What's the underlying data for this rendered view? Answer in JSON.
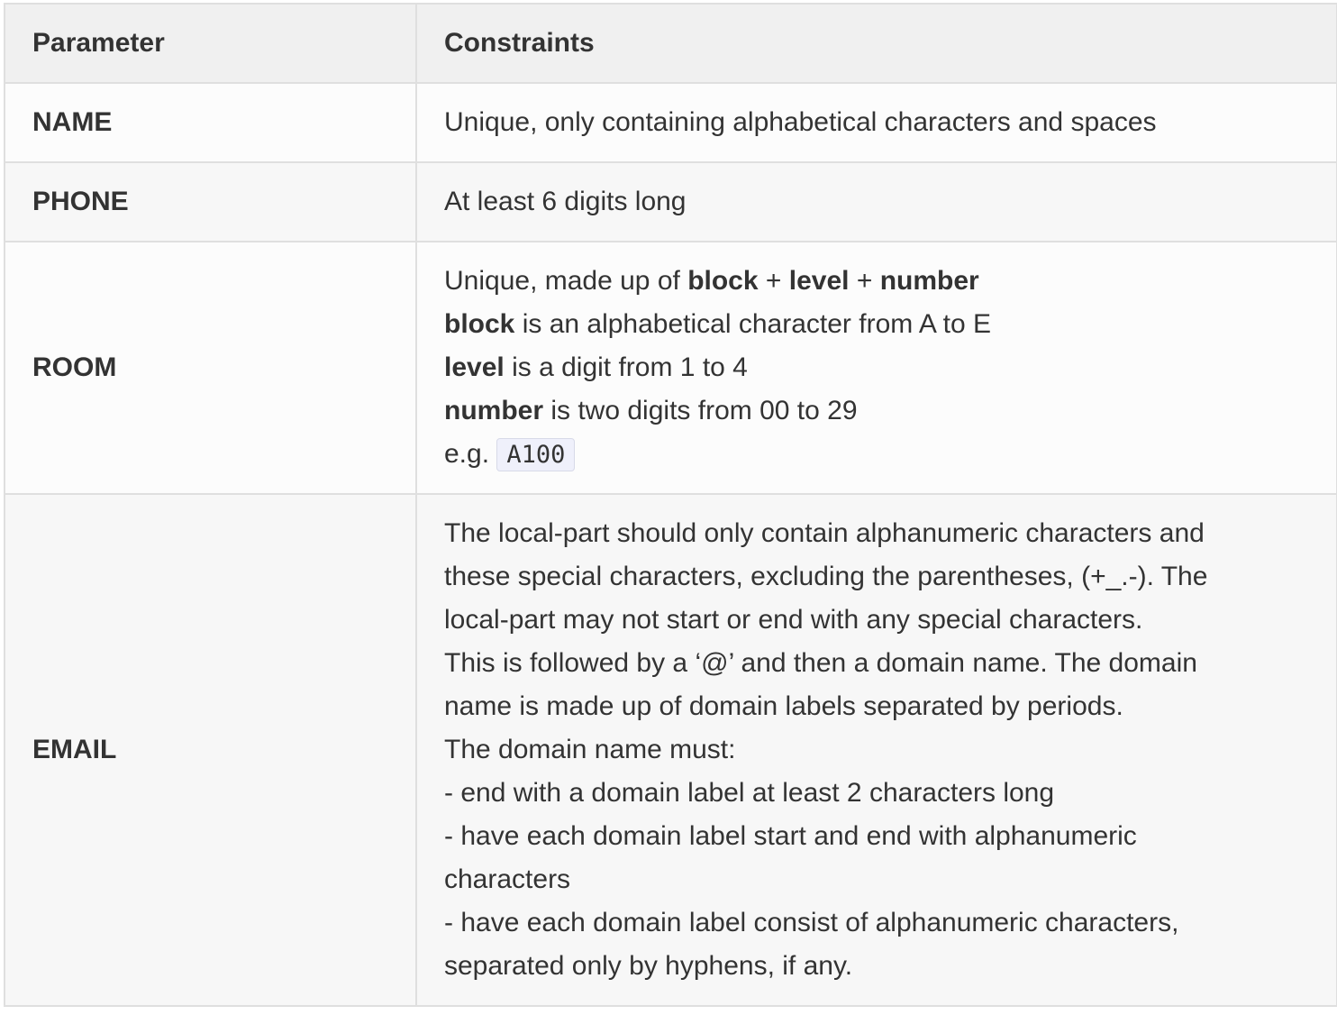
{
  "table": {
    "headers": {
      "parameter": "Parameter",
      "constraints": "Constraints"
    },
    "rows": {
      "name": {
        "param": "NAME",
        "constraint": "Unique, only containing alphabetical characters and spaces"
      },
      "phone": {
        "param": "PHONE",
        "constraint": "At least 6 digits long"
      },
      "room": {
        "param": "ROOM",
        "line1_prefix": "Unique, made up of ",
        "kw_block": "block",
        "plus": " + ",
        "kw_level": "level",
        "kw_number": "number",
        "line2_rest": " is an alphabetical character from A to E",
        "line3_rest": " is a digit from 1 to 4",
        "line4_rest": " is two digits from 00 to 29",
        "example_prefix": "e.g. ",
        "example_code": "A100"
      },
      "email": {
        "param": "EMAIL",
        "lines": [
          "The local-part should only contain alphanumeric characters and",
          "these special characters, excluding the parentheses, (+_.-). The",
          "local-part may not start or end with any special characters.",
          "This is followed by a ‘@’ and then a domain name. The domain",
          "name is made up of domain labels separated by periods.",
          "The domain name must:",
          "- end with a domain label at least 2 characters long",
          "- have each domain label start and end with alphanumeric",
          "characters",
          "- have each domain label consist of alphanumeric characters,",
          "separated only by hyphens, if any."
        ]
      }
    }
  }
}
